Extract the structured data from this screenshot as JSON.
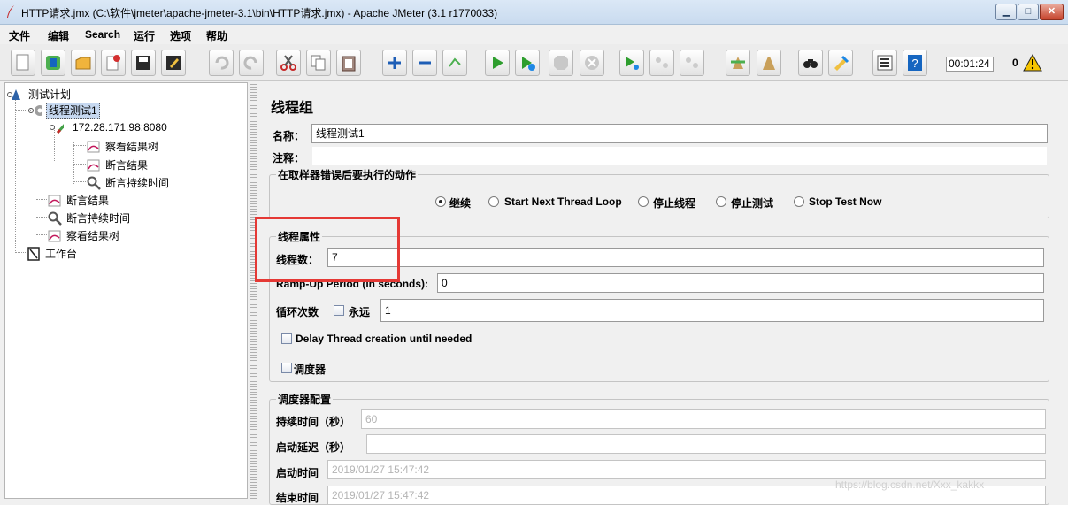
{
  "window": {
    "title": "HTTP请求.jmx (C:\\软件\\jmeter\\apache-jmeter-3.1\\bin\\HTTP请求.jmx) - Apache JMeter (3.1 r1770033)",
    "minimize": "▁",
    "maximize": "□",
    "close": "✕"
  },
  "menu": [
    "文件",
    "编辑",
    "Search",
    "运行",
    "选项",
    "帮助"
  ],
  "toolbar": {
    "timer": "00:01:24",
    "warning_count": "0",
    "icons": [
      "new-icon",
      "templates-icon",
      "open-icon",
      "close-icon",
      "save-icon",
      "save-as-icon",
      "undo-icon",
      "redo-icon",
      "cut-icon",
      "copy-icon",
      "paste-icon",
      "expand-icon",
      "collapse-icon",
      "toggle-icon",
      "start-icon",
      "start-no-pause-icon",
      "stop-icon",
      "shutdown-icon",
      "remote-start-icon",
      "remote-stop-icon",
      "remote-shutdown-icon",
      "clear-icon",
      "clear-all-icon",
      "search-icon",
      "reset-search-icon",
      "function-helper-icon",
      "help-icon"
    ]
  },
  "tree": {
    "nodes": [
      {
        "label": "测试计划",
        "icon": "test-plan-icon"
      },
      {
        "label": "线程测试1",
        "icon": "thread-group-icon"
      },
      {
        "label": "172.28.171.98:8080",
        "icon": "http-sampler-icon"
      },
      {
        "label": "察看结果树",
        "icon": "listener-icon"
      },
      {
        "label": "断言结果",
        "icon": "listener-icon"
      },
      {
        "label": "断言持续时间",
        "icon": "assertion-icon"
      },
      {
        "label": "断言结果",
        "icon": "listener-icon"
      },
      {
        "label": "断言持续时间",
        "icon": "assertion-icon"
      },
      {
        "label": "察看结果树",
        "icon": "listener-icon"
      },
      {
        "label": "工作台",
        "icon": "workbench-icon"
      }
    ]
  },
  "panel": {
    "title": "线程组",
    "name_label": "名称：",
    "name_value": "线程测试1",
    "comment_label": "注释：",
    "comment_value": "",
    "error_action": {
      "title": "在取样器错误后要执行的动作",
      "options": [
        "继续",
        "Start Next Thread Loop",
        "停止线程",
        "停止测试",
        "Stop Test Now"
      ],
      "selected": "继续"
    },
    "thread_props": {
      "title": "线程属性",
      "threads_label": "线程数：",
      "threads_value": "7",
      "rampup_label": "Ramp-Up Period (in seconds):",
      "rampup_value": "0",
      "loop_label": "循环次数",
      "forever_label": "永远",
      "loop_value": "1",
      "delay_label": "Delay Thread creation until needed",
      "scheduler_label": "调度器"
    },
    "scheduler": {
      "title": "调度器配置",
      "duration_label": "持续时间（秒）",
      "duration_value": "60",
      "delay_label": "启动延迟（秒）",
      "delay_value": "",
      "start_label": "启动时间",
      "start_value": "2019/01/27 15:47:42",
      "end_label": "结束时间",
      "end_value": "2019/01/27 15:47:42"
    }
  },
  "watermark": "https://blog.csdn.net/Xxx_kakkx",
  "colors": {
    "highlight": "#e53935",
    "selection": "#c6d8f0"
  }
}
